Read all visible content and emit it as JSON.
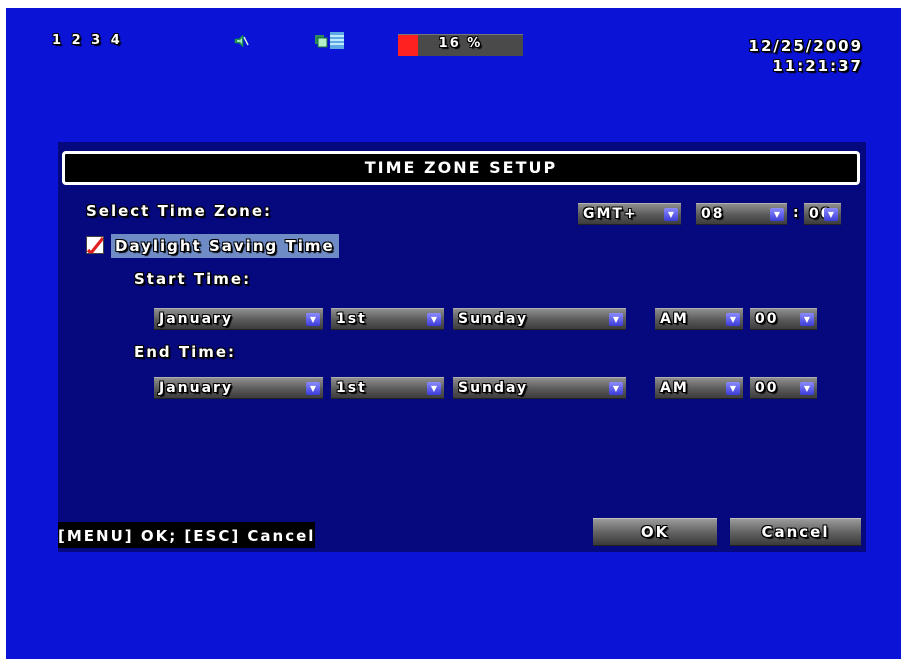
{
  "status_bar": {
    "camera_labels": "1 2 3 4",
    "hdd_usage_text": "16 %",
    "hdd_usage_percent": 16,
    "date": "12/25/2009",
    "time": "11:21:37",
    "icons": [
      "audio-icon",
      "record-icon"
    ]
  },
  "dialog": {
    "title": "TIME ZONE SETUP",
    "select_time_zone_label": "Select Time Zone:",
    "time_zone": {
      "prefix": "GMT+",
      "hour": "08",
      "separator": ":",
      "minute": "00"
    },
    "dst_label": "Daylight Saving Time",
    "dst_checked": true,
    "start_time_label": "Start Time:",
    "end_time_label": "End Time:",
    "start": {
      "month": "January",
      "week": "1st",
      "day": "Sunday",
      "ampm": "AM",
      "hour": "00"
    },
    "end": {
      "month": "January",
      "week": "1st",
      "day": "Sunday",
      "ampm": "AM",
      "hour": "00"
    },
    "footer_hint": "[MENU] OK; [ESC] Cancel",
    "ok_label": "OK",
    "cancel_label": "Cancel"
  },
  "colors": {
    "screen_bg": "#0a13d6",
    "panel_bg": "#06087e",
    "hdd_fill": "#ff2020",
    "highlight": "#6f8bc6"
  }
}
